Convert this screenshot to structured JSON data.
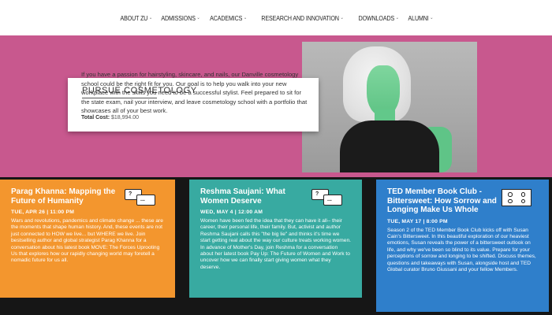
{
  "nav": {
    "items": [
      {
        "label": "ABOUT ZU"
      },
      {
        "label": "ADMISSIONS"
      },
      {
        "label": "ACADEMICS"
      },
      {
        "label": "RESEARCH AND INNOVATION"
      },
      {
        "label": "DOWNLOADS"
      },
      {
        "label": "ALUMNI"
      }
    ]
  },
  "hero": {
    "card_title": "PURSUE COSMETOLOGY",
    "card_text": "If you have a passion for hairstyling, skincare, and nails, our Danville cosmetology school could be the right fit for you. Our goal is to help you walk into your new workplace with the skills you need to be a successful stylist. Feel prepared to sit for the state exam, nail your interview, and leave cosmetology school with a portfolio that showcases all of your best work.",
    "cost_label": "Total Cost:",
    "cost_value": "$18,994.00"
  },
  "panels": [
    {
      "title": "Parag Khanna: Mapping the Future of Humanity",
      "date": "TUE, APR 26 | 11:00 PM",
      "body": "Wars and revolutions, pandemics and climate change ... these are the moments that shape human history. And, these events are not just connected to HOW we live... but WHERE we live. Join bestselling author and global strategist Parag Khanna for a conversation about his latest book MOVE: The Forces Uprooting Us that explores how our rapidly changing world may foretell a nomadic future for us all.",
      "icon": "chat-bubbles-icon",
      "color": "#f3962e"
    },
    {
      "title": "Reshma Saujani: What Women Deserve",
      "date": "WED, MAY 4 | 12:00 AM",
      "body": "Women have been fed the idea that they can have it all-- their career, their personal life, their family. But, activist and author Reshma Saujani calls this \"the big lie\" and thinks it's time we start getting real about the way our culture treats working women. In advance of Mother's Day, join Reshma for a conversation about her latest book Pay Up: The Future of Women and Work to uncover how we can finally start giving women what they deserve.",
      "icon": "chat-bubbles-icon",
      "color": "#38aaa1"
    },
    {
      "title": "TED Member Book Club - Bittersweet: How Sorrow and Longing Make Us Whole",
      "date": "TUE, MAY 17 | 8:00 PM",
      "body": "Season 2 of the TED Member Book Club kicks off with Susan Cain's Bittersweet. In this beautiful exploration of our heaviest emotions, Susan reveals the power of a bittersweet outlook on life, and why we've been so blind to its value. Prepare for your perceptions of sorrow and longing to be shifted. Discuss themes, questions and takeaways with Susan, alongside host and TED Global curator Bruno Giussani and your fellow Members.",
      "icon": "video-grid-icon",
      "color": "#2f7fcb"
    }
  ]
}
